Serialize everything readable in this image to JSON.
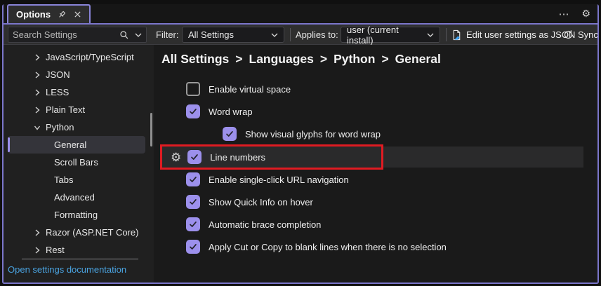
{
  "tab": {
    "title": "Options"
  },
  "icons": {
    "gear": "⚙",
    "ellipsis": "⋯"
  },
  "toolbar": {
    "search_placeholder": "Search Settings",
    "filter_label": "Filter:",
    "filter_value": "All Settings",
    "applies_to_label": "Applies to:",
    "applies_to_value": "user (current install)",
    "edit_json_label": "Edit user settings as JSON",
    "sync_label": "Sync"
  },
  "sidebar": {
    "items": [
      {
        "label": "JavaScript/TypeScript",
        "chevron": "collapsed",
        "level": 0,
        "selected": false
      },
      {
        "label": "JSON",
        "chevron": "collapsed",
        "level": 0,
        "selected": false
      },
      {
        "label": "LESS",
        "chevron": "collapsed",
        "level": 0,
        "selected": false
      },
      {
        "label": "Plain Text",
        "chevron": "collapsed",
        "level": 0,
        "selected": false
      },
      {
        "label": "Python",
        "chevron": "expanded",
        "level": 0,
        "selected": false
      },
      {
        "label": "General",
        "chevron": "none",
        "level": 1,
        "selected": true
      },
      {
        "label": "Scroll Bars",
        "chevron": "none",
        "level": 1,
        "selected": false
      },
      {
        "label": "Tabs",
        "chevron": "none",
        "level": 1,
        "selected": false
      },
      {
        "label": "Advanced",
        "chevron": "none",
        "level": 1,
        "selected": false
      },
      {
        "label": "Formatting",
        "chevron": "none",
        "level": 1,
        "selected": false
      },
      {
        "label": "Razor (ASP.NET Core)",
        "chevron": "collapsed",
        "level": 0,
        "selected": false
      },
      {
        "label": "Rest",
        "chevron": "collapsed",
        "level": 0,
        "selected": false
      }
    ],
    "doc_link": "Open settings documentation"
  },
  "breadcrumb": {
    "separator": ">",
    "segments": [
      "All Settings",
      "Languages",
      "Python",
      "General"
    ]
  },
  "settings": {
    "rows": [
      {
        "label": "Enable virtual space",
        "checked": false,
        "indent": 0,
        "highlighted": false,
        "gear": false,
        "annotated": false
      },
      {
        "label": "Word wrap",
        "checked": true,
        "indent": 0,
        "highlighted": false,
        "gear": false,
        "annotated": false
      },
      {
        "label": "Show visual glyphs for word wrap",
        "checked": true,
        "indent": 1,
        "highlighted": false,
        "gear": false,
        "annotated": false
      },
      {
        "label": "Line numbers",
        "checked": true,
        "indent": 0,
        "highlighted": true,
        "gear": true,
        "annotated": true
      },
      {
        "label": "Enable single-click URL navigation",
        "checked": true,
        "indent": 0,
        "highlighted": false,
        "gear": false,
        "annotated": false
      },
      {
        "label": "Show Quick Info on hover",
        "checked": true,
        "indent": 0,
        "highlighted": false,
        "gear": false,
        "annotated": false
      },
      {
        "label": "Automatic brace completion",
        "checked": true,
        "indent": 0,
        "highlighted": false,
        "gear": false,
        "annotated": false
      },
      {
        "label": "Apply Cut or Copy to blank lines when there is no selection",
        "checked": true,
        "indent": 0,
        "highlighted": false,
        "gear": false,
        "annotated": false
      }
    ]
  },
  "colors": {
    "accent_purple": "#9c90ec",
    "window_border": "#7b76cb",
    "annotation_red": "#e01b22",
    "link_blue": "#4aa3e0",
    "row_highlight": "#2a2a2b",
    "selected_bg": "#34343a"
  }
}
